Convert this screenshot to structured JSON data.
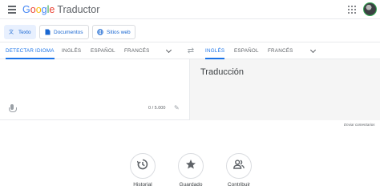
{
  "header": {
    "logo_letters": [
      "G",
      "o",
      "o",
      "g",
      "l",
      "e"
    ],
    "product": "Traductor"
  },
  "modes": [
    {
      "label": "Texto",
      "icon": "translate-icon",
      "active": true
    },
    {
      "label": "Documentos",
      "icon": "document-icon",
      "active": false
    },
    {
      "label": "Sitios web",
      "icon": "globe-icon",
      "active": false
    }
  ],
  "source_langs": [
    "DETECTAR IDIOMA",
    "INGLÉS",
    "ESPAÑOL",
    "FRANCÉS"
  ],
  "target_langs": [
    "INGLÉS",
    "ESPAÑOL",
    "FRANCÉS"
  ],
  "source": {
    "value": "",
    "char_count": "0 / 5.000"
  },
  "target": {
    "placeholder": "Traducción"
  },
  "feedback": "Enviar comentarios",
  "bottom_actions": [
    {
      "label": "Historial",
      "icon": "history-icon"
    },
    {
      "label": "Guardado",
      "icon": "star-icon"
    },
    {
      "label": "Contribuir",
      "icon": "people-icon"
    }
  ],
  "colors": {
    "accent": "#1a73e8",
    "mode_active_bg": "#e8f0fe",
    "target_bg": "#f5f5f5"
  }
}
